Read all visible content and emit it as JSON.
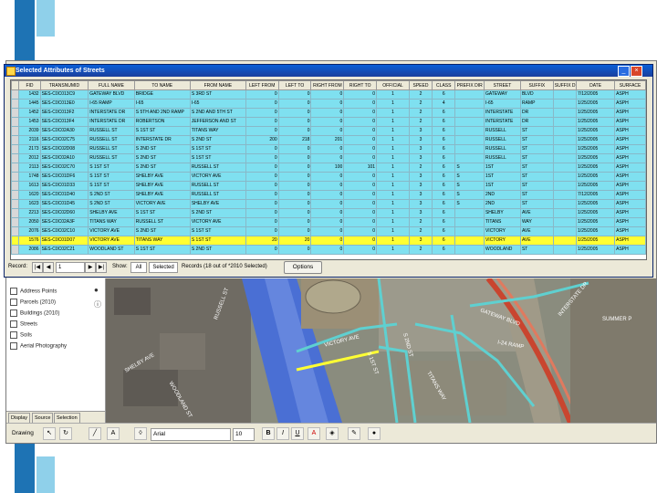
{
  "colors": {
    "deco_blue": "#1e73b4",
    "deco_light": "#8fd0ea",
    "row_fill": "#7fe0f0",
    "row_highlight": "#ffff33"
  },
  "dialog": {
    "title": "Selected Attributes of Streets",
    "columns": [
      "FID",
      "TRANSNUMID",
      "FULL NAME",
      "TO NAME",
      "FROM NAME",
      "LEFT FROM",
      "LEFT TO",
      "RIGHT FROM",
      "RIGHT TO",
      "OFFICIAL",
      "SPEED",
      "CLASS",
      "PREFIX DIR",
      "STREET",
      "SUFFIX",
      "SUFFIX DIR",
      "DATE",
      "SURFACE"
    ],
    "rows": [
      [
        "1432",
        "SES-C0C013C9",
        "GATEWAY BLVD",
        "BRIDGE",
        "S 3RD ST",
        "0",
        "0",
        "0",
        "0",
        "1",
        "2",
        "6",
        "",
        "GATEWAY",
        "BLVD",
        "",
        "7/12/2005",
        "ASPH"
      ],
      [
        "1445",
        "SES-C0C013E0",
        "I-65 RAMP",
        "I-65",
        "I-65",
        "0",
        "0",
        "0",
        "0",
        "1",
        "2",
        "4",
        "",
        "I-65",
        "RAMP",
        "",
        "1/25/2005",
        "ASPH"
      ],
      [
        "1452",
        "SES-C0C013F2",
        "INTERSTATE DR",
        "S 5TH AND 2ND RAMP",
        "S 2ND AND 5TH ST",
        "0",
        "0",
        "0",
        "0",
        "1",
        "2",
        "6",
        "",
        "INTERSTATE",
        "DR",
        "",
        "1/25/2005",
        "ASPH"
      ],
      [
        "1453",
        "SES-C0C013F4",
        "INTERSTATE DR",
        "ROBERTSON",
        "JEFFERSON AND ST",
        "0",
        "0",
        "0",
        "0",
        "1",
        "2",
        "6",
        "",
        "INTERSTATE",
        "DR",
        "",
        "1/25/2005",
        "ASPH"
      ],
      [
        "2039",
        "SES-C0C02A30",
        "RUSSELL ST",
        "S 1ST ST",
        "TITANS WAY",
        "0",
        "0",
        "0",
        "0",
        "1",
        "3",
        "6",
        "",
        "RUSSELL",
        "ST",
        "",
        "1/25/2005",
        "ASPH"
      ],
      [
        "2116",
        "SES-C0C02C75",
        "RUSSELL ST",
        "INTERSTATE DR",
        "S 2ND ST",
        "200",
        "218",
        "201",
        "0",
        "1",
        "3",
        "6",
        "",
        "RUSSELL",
        "ST",
        "",
        "1/25/2005",
        "ASPH"
      ],
      [
        "2173",
        "SES-C0C02D08",
        "RUSSELL ST",
        "S 2ND ST",
        "S 1ST ST",
        "0",
        "0",
        "0",
        "0",
        "1",
        "3",
        "6",
        "",
        "RUSSELL",
        "ST",
        "",
        "1/25/2005",
        "ASPH"
      ],
      [
        "2012",
        "SES-C0C02A10",
        "RUSSELL ST",
        "S 2ND ST",
        "S 1ST ST",
        "0",
        "0",
        "0",
        "0",
        "1",
        "3",
        "6",
        "",
        "RUSSELL",
        "ST",
        "",
        "1/25/2005",
        "ASPH"
      ],
      [
        "2113",
        "SES-C0C02C70",
        "S 1ST ST",
        "S 2ND ST",
        "RUSSELL ST",
        "0",
        "0",
        "100",
        "101",
        "1",
        "2",
        "6",
        "S",
        "1ST",
        "ST",
        "",
        "1/25/2005",
        "ASPH"
      ],
      [
        "1748",
        "SES-C0C01DF6",
        "S 1ST ST",
        "SHELBY AVE",
        "VICTORY AVE",
        "0",
        "0",
        "0",
        "0",
        "1",
        "3",
        "6",
        "S",
        "1ST",
        "ST",
        "",
        "1/25/2005",
        "ASPH"
      ],
      [
        "1613",
        "SES-C0C01D33",
        "S 1ST ST",
        "SHELBY AVE",
        "RUSSELL ST",
        "0",
        "0",
        "0",
        "0",
        "1",
        "3",
        "6",
        "S",
        "1ST",
        "ST",
        "",
        "1/25/2005",
        "ASPH"
      ],
      [
        "1620",
        "SES-C0C01D40",
        "S 2ND ST",
        "SHELBY AVE",
        "RUSSELL ST",
        "0",
        "0",
        "0",
        "0",
        "1",
        "3",
        "6",
        "S",
        "2ND",
        "ST",
        "",
        "7/12/2005",
        "ASPH"
      ],
      [
        "1623",
        "SES-C0C01D45",
        "S 2ND ST",
        "VICTORY AVE",
        "SHELBY AVE",
        "0",
        "0",
        "0",
        "0",
        "1",
        "3",
        "6",
        "S",
        "2ND",
        "ST",
        "",
        "1/25/2005",
        "ASPH"
      ],
      [
        "2213",
        "SES-C0C02D60",
        "SHELBY AVE",
        "S 1ST ST",
        "S 2ND ST",
        "0",
        "0",
        "0",
        "0",
        "1",
        "3",
        "6",
        "",
        "SHELBY",
        "AVE",
        "",
        "1/25/2005",
        "ASPH"
      ],
      [
        "2050",
        "SES-C0C02A3F",
        "TITANS WAY",
        "RUSSELL ST",
        "VICTORY AVE",
        "0",
        "0",
        "0",
        "0",
        "1",
        "2",
        "6",
        "",
        "TITANS",
        "WAY",
        "",
        "1/25/2005",
        "ASPH"
      ],
      [
        "2076",
        "SES-C0C02C10",
        "VICTORY AVE",
        "S 2ND ST",
        "S 1ST ST",
        "0",
        "0",
        "0",
        "0",
        "1",
        "2",
        "6",
        "",
        "VICTORY",
        "AVE",
        "",
        "1/25/2005",
        "ASPH"
      ],
      [
        "1576",
        "SES-C0C01D07",
        "VICTORY AVE",
        "TITANS WAY",
        "S 1ST ST",
        "20",
        "20",
        "0",
        "0",
        "1",
        "3",
        "6",
        "",
        "VICTORY",
        "AVE",
        "",
        "1/25/2005",
        "ASPH"
      ],
      [
        "2086",
        "SES-C0C02C21",
        "WOODLAND ST",
        "S 1ST ST",
        "S 2ND ST",
        "0",
        "0",
        "0",
        "0",
        "1",
        "2",
        "6",
        "",
        "WOODLAND",
        "ST",
        "",
        "1/25/2005",
        "ASPH"
      ]
    ],
    "highlight_row_index": 16,
    "footer": {
      "record_label": "Record:",
      "record_value": "1",
      "show_label": "Show:",
      "all_label": "All",
      "selected_label": "Selected",
      "records_text": "Records (18 out of *2010 Selected)",
      "options_label": "Options"
    }
  },
  "toc": {
    "items": [
      {
        "label": "Address Points"
      },
      {
        "label": "Parcels (2010)"
      },
      {
        "label": "Buildings (2010)"
      },
      {
        "label": "Streets"
      },
      {
        "label": "Soils"
      },
      {
        "label": "Aerial Photography"
      }
    ],
    "tabs": [
      "Display",
      "Source",
      "Selection"
    ]
  },
  "map": {
    "labels": [
      "VICTORY AVE",
      "S 1ST ST",
      "S 2ND ST",
      "TITANS WAY",
      "RUSSELL ST",
      "SHELBY AVE",
      "WOODLAND ST",
      "GATEWAY BLVD",
      "INTERSTATE DR",
      "I-24 RAMP",
      "SUMMER P"
    ]
  },
  "statusbar": {
    "drawing_label": "Drawing",
    "font_name": "Arial",
    "font_size": "10",
    "bold": "B",
    "italic": "I",
    "underline": "U"
  }
}
